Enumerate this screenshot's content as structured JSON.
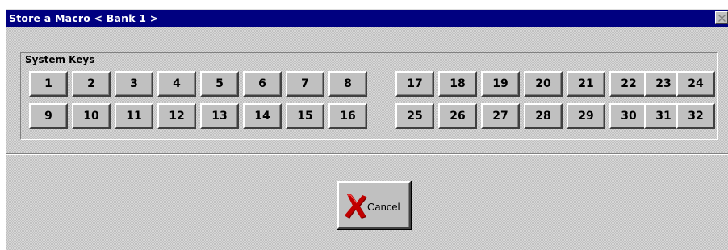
{
  "window": {
    "title": "Store a Macro < Bank 1 >"
  },
  "system_keys": {
    "label": "System Keys",
    "left_block": {
      "row1": [
        "1",
        "2",
        "3",
        "4",
        "5",
        "6",
        "7",
        "8"
      ],
      "row2": [
        "9",
        "10",
        "11",
        "12",
        "13",
        "14",
        "15",
        "16"
      ]
    },
    "right_block": {
      "row1": [
        "17",
        "18",
        "19",
        "20",
        "21",
        "22",
        "23",
        "24"
      ],
      "row2": [
        "25",
        "26",
        "27",
        "28",
        "29",
        "30",
        "31",
        "32"
      ]
    }
  },
  "cancel_button": {
    "label": "Cancel",
    "icon": "red-x-icon"
  },
  "colors": {
    "titlebar": "#000080",
    "face": "#c0c0c0",
    "cancel_x": "#c00000"
  }
}
